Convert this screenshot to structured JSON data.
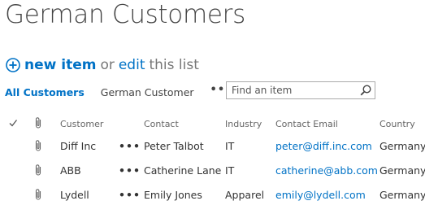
{
  "page_title": "German Customers",
  "quick_edit": {
    "new_item_label": "new item",
    "or_text": "or",
    "edit_label": "edit",
    "this_list_text": "this list"
  },
  "views": {
    "all_customers": "All Customers",
    "german_customer": "German Customer",
    "more": "•••"
  },
  "search": {
    "placeholder": "Find an item"
  },
  "table": {
    "columns": {
      "customer": "Customer",
      "contact": "Contact",
      "industry": "Industry",
      "contact_email": "Contact Email",
      "country": "Country"
    },
    "ellipsis": "•••",
    "rows": [
      {
        "customer": "Diff Inc",
        "contact": "Peter Talbot",
        "industry": "IT",
        "email": "peter@diff.inc.com",
        "country": "Germany"
      },
      {
        "customer": "ABB",
        "contact": "Catherine Lane",
        "industry": "IT",
        "email": "catherine@abb.com",
        "country": "Germany"
      },
      {
        "customer": "Lydell",
        "contact": "Emily Jones",
        "industry": "Apparel",
        "email": "emily@lydell.com",
        "country": "Germany"
      }
    ]
  },
  "colors": {
    "accent": "#0072c6",
    "text": "#333333",
    "muted": "#777777"
  },
  "icons": {
    "add": "plus-circle-icon",
    "search": "magnifier-icon",
    "check": "checkmark-icon",
    "attachment": "paperclip-icon"
  }
}
